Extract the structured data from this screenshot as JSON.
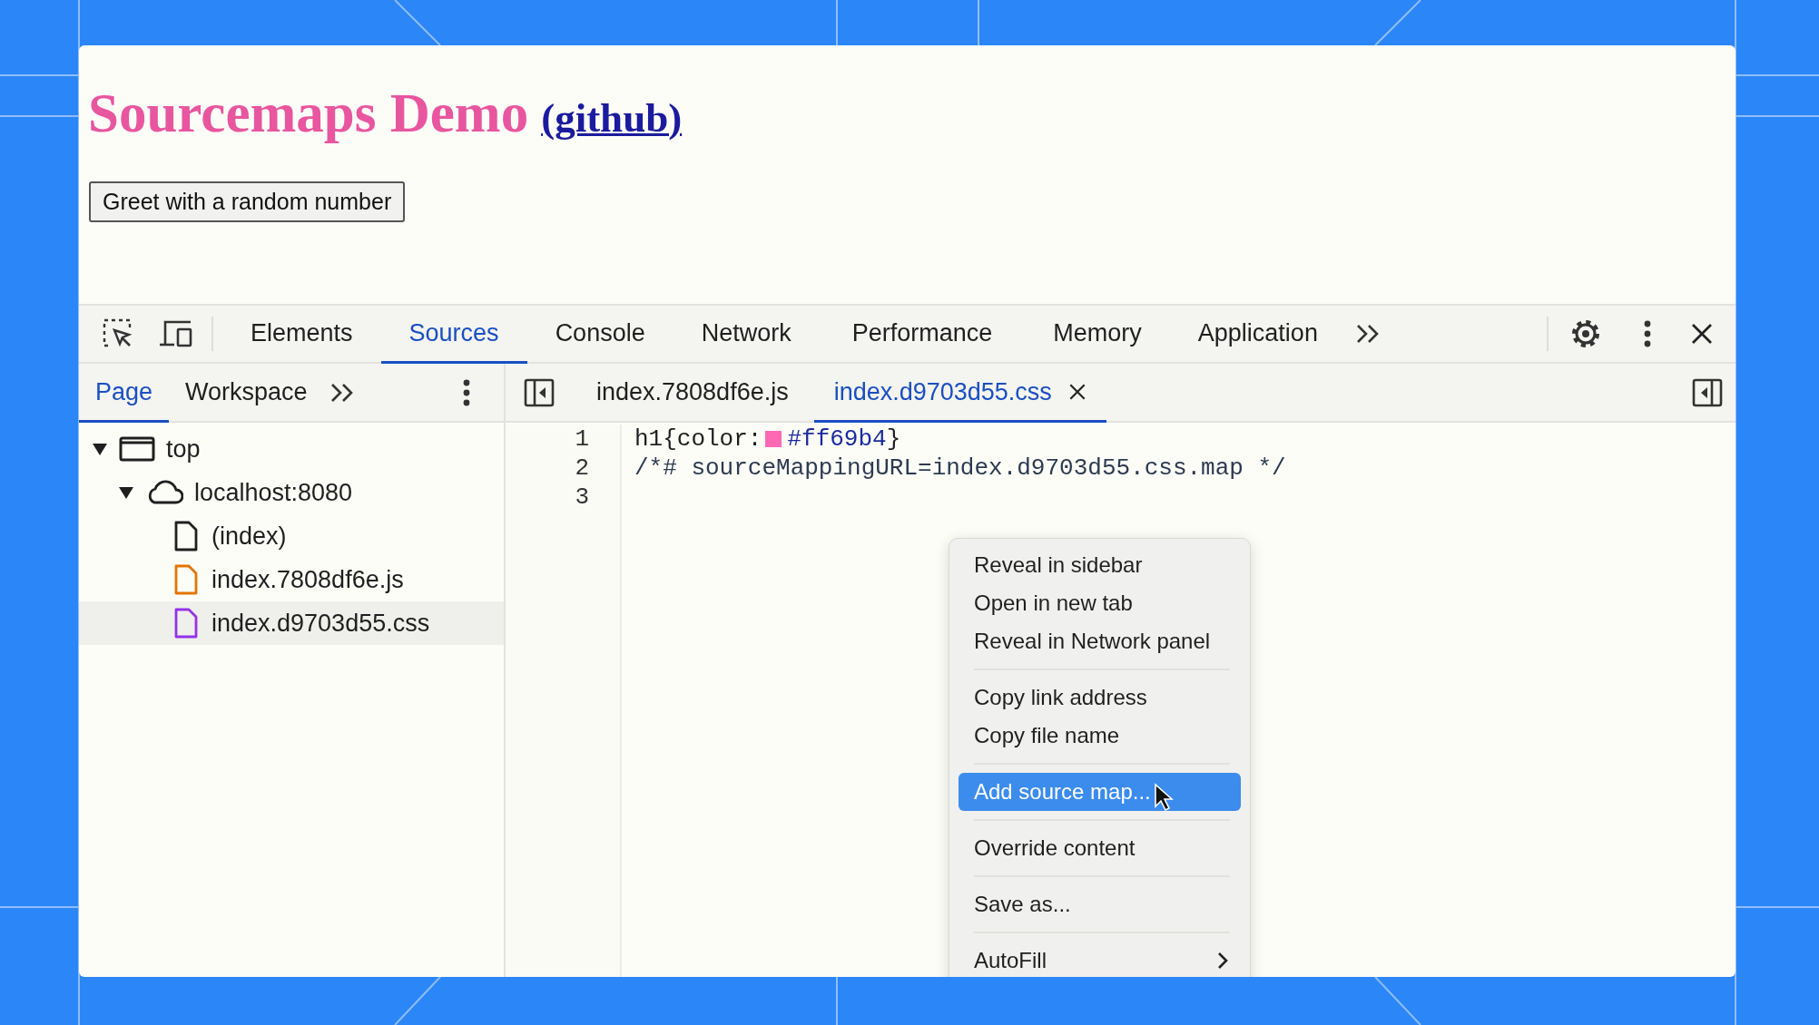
{
  "page": {
    "heading": "Sourcemaps Demo",
    "link": "(github)",
    "button": "Greet with a random number"
  },
  "devtools": {
    "tabs": [
      {
        "label": "Elements",
        "selected": false
      },
      {
        "label": "Sources",
        "selected": true
      },
      {
        "label": "Console",
        "selected": false
      },
      {
        "label": "Network",
        "selected": false
      },
      {
        "label": "Performance",
        "selected": false
      },
      {
        "label": "Memory",
        "selected": false
      },
      {
        "label": "Application",
        "selected": false
      }
    ],
    "navigator_tabs": [
      {
        "label": "Page",
        "selected": true
      },
      {
        "label": "Workspace",
        "selected": false
      }
    ],
    "editor_tabs": [
      {
        "label": "index.7808df6e.js",
        "selected": false
      },
      {
        "label": "index.d9703d55.css",
        "selected": true
      }
    ],
    "tree": [
      {
        "label": "top",
        "kind": "frame",
        "expanded": true,
        "selected": false,
        "children": [
          {
            "label": "localhost:8080",
            "kind": "cloud",
            "expanded": true,
            "selected": false,
            "children": [
              {
                "label": "(index)",
                "kind": "file",
                "color": "#1f1f1f",
                "selected": false
              },
              {
                "label": "index.7808df6e.js",
                "kind": "file",
                "color": "#e37400",
                "selected": false
              },
              {
                "label": "index.d9703d55.css",
                "kind": "file",
                "color": "#9334e6",
                "selected": true
              }
            ]
          }
        ]
      }
    ],
    "code": [
      {
        "number": "1",
        "tokens": [
          {
            "kind": "plain",
            "text": "h1{color:"
          },
          {
            "kind": "swatch",
            "color": "#ff69b4"
          },
          {
            "kind": "value",
            "text": "#ff69b4"
          },
          {
            "kind": "plain",
            "text": "}"
          }
        ]
      },
      {
        "number": "2",
        "tokens": [
          {
            "kind": "comment",
            "text": "/*# sourceMappingURL=index.d9703d55.css.map */"
          }
        ]
      },
      {
        "number": "3"
      }
    ],
    "context_menu": {
      "groups": [
        [
          {
            "label": "Reveal in sidebar",
            "selected": false,
            "submenu": false
          },
          {
            "label": "Open in new tab",
            "selected": false,
            "submenu": false
          },
          {
            "label": "Reveal in Network panel",
            "selected": false,
            "submenu": false
          }
        ],
        [
          {
            "label": "Copy link address",
            "selected": false,
            "submenu": false
          },
          {
            "label": "Copy file name",
            "selected": false,
            "submenu": false
          }
        ],
        [
          {
            "label": "Add source map...",
            "selected": true,
            "submenu": false
          }
        ],
        [
          {
            "label": "Override content",
            "selected": false,
            "submenu": false
          }
        ],
        [
          {
            "label": "Save as...",
            "selected": false,
            "submenu": false
          }
        ],
        [
          {
            "label": "AutoFill",
            "selected": false,
            "submenu": true
          }
        ]
      ]
    }
  }
}
